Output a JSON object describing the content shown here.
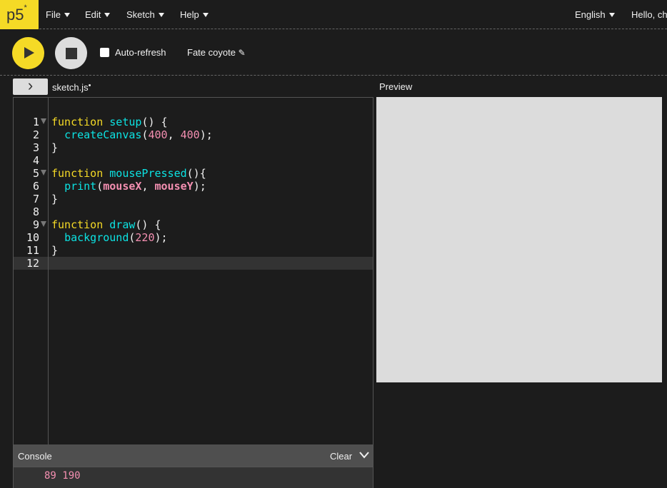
{
  "nav": {
    "logo": "p5",
    "logo_mark": "*",
    "menus": [
      "File",
      "Edit",
      "Sketch",
      "Help"
    ],
    "language": "English",
    "greeting": "Hello, ch"
  },
  "toolbar": {
    "auto_refresh_label": "Auto-refresh",
    "auto_refresh_checked": false,
    "sketch_name": "Fate coyote",
    "pencil_icon": "✎"
  },
  "editor": {
    "toggle_icon": "›",
    "file_name": "sketch.js",
    "unsaved_dot": "•",
    "line_numbers": [
      "1",
      "2",
      "3",
      "4",
      "5",
      "6",
      "7",
      "8",
      "9",
      "10",
      "11",
      "12"
    ],
    "tokens": {
      "l1": [
        "function",
        "setup",
        "() {"
      ],
      "l2": [
        "createCanvas",
        "(",
        "400",
        ", ",
        "400",
        ");"
      ],
      "l3": "}",
      "l5": [
        "function",
        "mousePressed",
        "(){"
      ],
      "l6": [
        "print",
        "(",
        "mouseX",
        ", ",
        "mouseY",
        ");"
      ],
      "l7": "}",
      "l9": [
        "function",
        "draw",
        "() {"
      ],
      "l10": [
        "background",
        "(",
        "220",
        ");"
      ],
      "l11": "}"
    }
  },
  "preview": {
    "label": "Preview",
    "canvas_color": "#dcdcdc"
  },
  "console": {
    "title": "Console",
    "clear_label": "Clear",
    "output": "89 190"
  },
  "colors": {
    "accent": "#f5da26",
    "keyword": "#f5da26",
    "function": "#0ce3e3",
    "number": "#f48fb1"
  }
}
